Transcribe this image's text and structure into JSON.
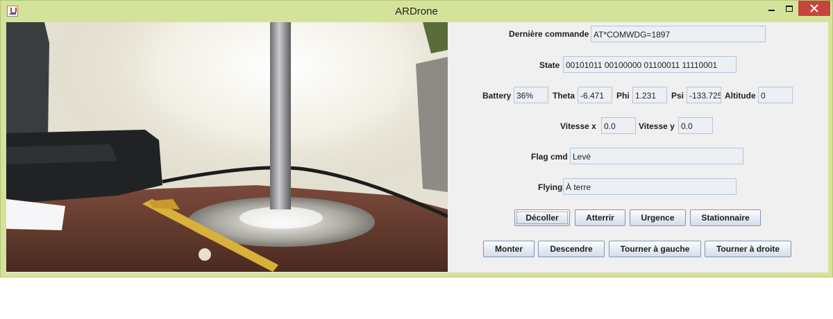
{
  "window": {
    "title": "ARDrone"
  },
  "status": {
    "derniere_commande": {
      "label": "Dernière commande",
      "value": "AT*COMWDG=1897"
    },
    "state": {
      "label": "State",
      "value": "00101011 00100000 01100011 11110001"
    },
    "battery": {
      "label": "Battery",
      "value": "36%"
    },
    "theta": {
      "label": "Theta",
      "value": "-6.471"
    },
    "phi": {
      "label": "Phi",
      "value": "1.231"
    },
    "psi": {
      "label": "Psi",
      "value": "-133.725"
    },
    "altitude": {
      "label": "Altitude",
      "value": "0"
    },
    "vitesse_x": {
      "label": "Vitesse x",
      "value": "0.0"
    },
    "vitesse_y": {
      "label": "Vitesse y",
      "value": "0.0"
    },
    "flag_cmd": {
      "label": "Flag cmd",
      "value": "Levé"
    },
    "flying": {
      "label": "Flying",
      "value": "À terre"
    }
  },
  "buttons": {
    "decoller": "Décoller",
    "atterrir": "Atterrir",
    "urgence": "Urgence",
    "stationnaire": "Stationnaire",
    "monter": "Monter",
    "descendre": "Descendre",
    "tourner_gauche": "Tourner à gauche",
    "tourner_droite": "Tourner à droite"
  },
  "colors": {
    "window_frame": "#d5e39a",
    "close_button": "#c7443c",
    "panel_background": "#f0f0f0",
    "field_border": "#b5c5d8"
  }
}
